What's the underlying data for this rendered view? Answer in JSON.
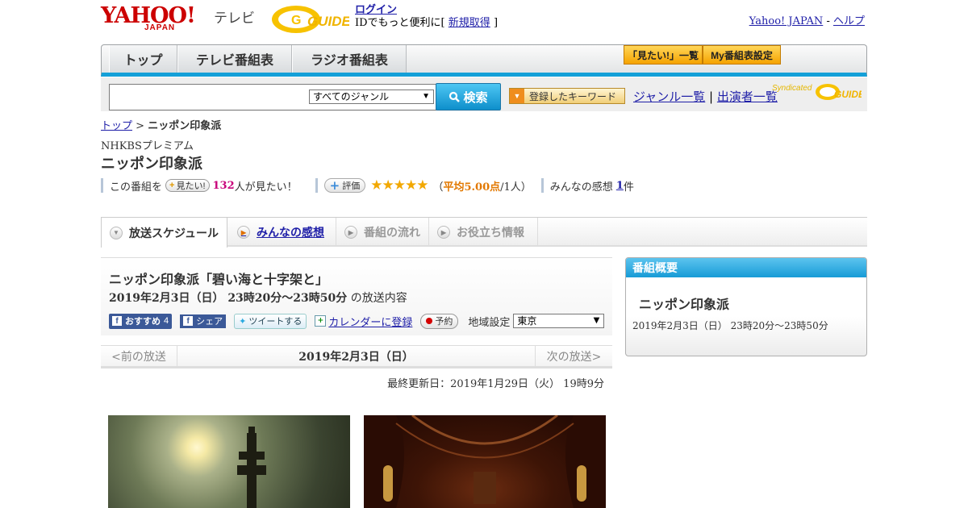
{
  "header": {
    "yahoo_logo": "YAHOO!",
    "yahoo_japan": "JAPAN",
    "tv_label": "テレビ",
    "gguide_logo": "G GUIDE",
    "login": "ログイン",
    "login_note_prefix": "IDでもっと便利に[",
    "register": "新規取得",
    "login_note_suffix": "]",
    "yahoo_japan_link": "Yahoo! JAPAN",
    "sep": "-",
    "help_link": "ヘルプ"
  },
  "nav": {
    "tabs": [
      "トップ",
      "テレビ番組表",
      "ラジオ番組表"
    ],
    "mitai_list": "「見たい!」一覧",
    "my_schedule": "My番組表設定"
  },
  "search": {
    "genre": "すべてのジャンル",
    "button": "検索",
    "keyword_button": "登録したキーワード",
    "genre_list": "ジャンル一覧",
    "divider": "|",
    "performer_list": "出演者一覧",
    "syndicated": "Syndicated"
  },
  "breadcrumb": {
    "top": "トップ",
    "sep": ">",
    "current": "ニッポン印象派"
  },
  "program": {
    "channel": "NHKBSプレミアム",
    "title": "ニッポン印象派",
    "mitai_prefix": "この番組を",
    "mitai_button": "見たい!",
    "mitai_count": "132",
    "mitai_suffix": "人が見たい！",
    "rating_button": "評価",
    "stars": "★★★★★",
    "rating_open": "（",
    "rating_avg": "平均5.00点",
    "rating_count": "/1人）",
    "review_prefix": "みんなの感想",
    "review_count": "1",
    "review_suffix": "件"
  },
  "tabs": [
    {
      "label": "放送スケジュール"
    },
    {
      "label": "みんなの感想"
    },
    {
      "label": "番組の流れ"
    },
    {
      "label": "お役立ち情報"
    }
  ],
  "episode": {
    "title": "ニッポン印象派「碧い海と十字架と」",
    "time": "2019年2月3日（日） 23時20分～23時50分",
    "time_suffix": "の放送内容",
    "fb_recommend": "おすすめ",
    "fb_count": "4",
    "fb_share": "シェア",
    "tweet": "ツイートする",
    "calendar": "カレンダーに登録",
    "reserve": "予約",
    "region_label": "地域設定",
    "region": "東京",
    "prev": "<前の放送",
    "date": "2019年2月3日（日）",
    "next": "次の放送>",
    "updated": "最終更新日：2019年1月29日（火） 19時9分"
  },
  "overview": {
    "heading": "番組概要",
    "title": "ニッポン印象派",
    "time": "2019年2月3日（日） 23時20分～23時50分"
  },
  "colors": {
    "accent_blue": "#14a0d8",
    "link": "#1f1fa8",
    "yahoo_red": "#cc0000",
    "count_magenta": "#c8007a",
    "star_gold": "#f2a800"
  }
}
